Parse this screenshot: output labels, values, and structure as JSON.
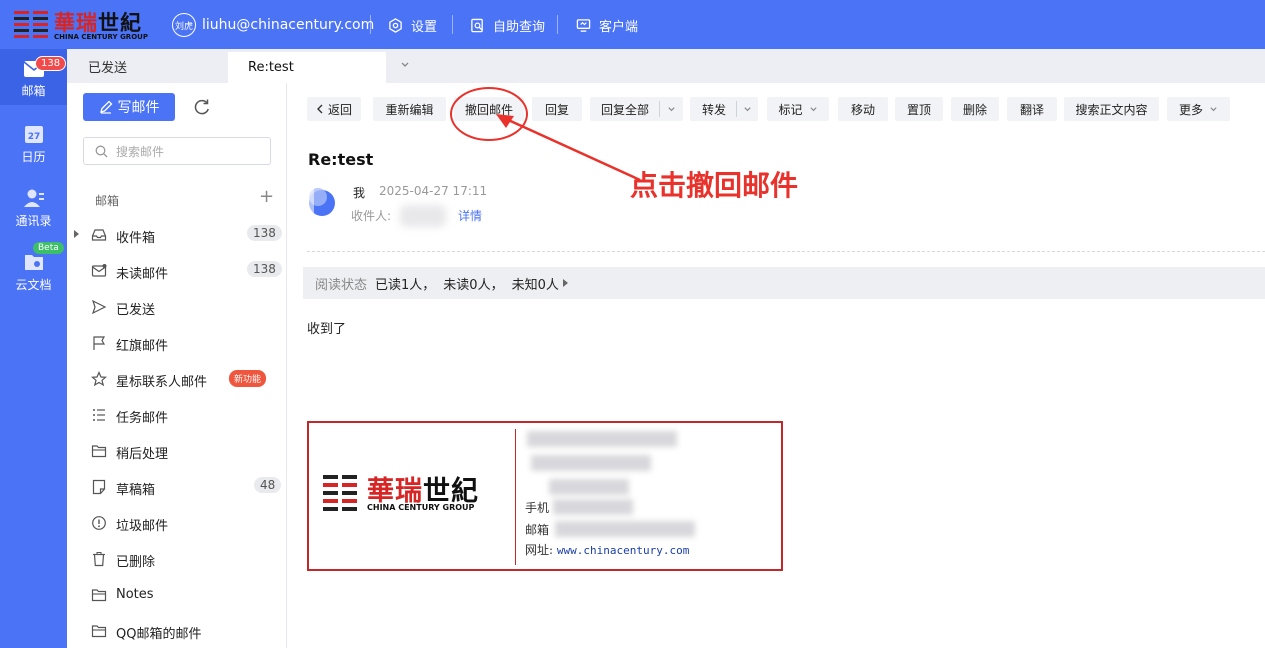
{
  "header": {
    "logo": {
      "cn_red": "華瑞",
      "cn_black": "世紀",
      "en": "CHINA CENTURY GROUP"
    },
    "user_avatar_text": "刘虎",
    "user_email": "liuhu@chinacentury.com",
    "links": [
      {
        "label": "设置",
        "icon": "gear-icon"
      },
      {
        "label": "自助查询",
        "icon": "search-doc-icon"
      },
      {
        "label": "客户端",
        "icon": "monitor-icon"
      }
    ]
  },
  "leftnav": {
    "items": [
      {
        "label": "邮箱",
        "icon": "mail-icon",
        "badge": "138",
        "active": true
      },
      {
        "label": "日历",
        "icon": "calendar-icon",
        "day": "27"
      },
      {
        "label": "通讯录",
        "icon": "contacts-icon"
      },
      {
        "label": "云文档",
        "icon": "cloud-doc-icon",
        "badge": "Beta"
      }
    ]
  },
  "tabs": [
    {
      "label": "已发送"
    },
    {
      "label": "Re:test"
    }
  ],
  "folders": {
    "write_label": "写邮件",
    "search_placeholder": "搜索邮件",
    "section_label": "邮箱",
    "items": [
      {
        "label": "收件箱",
        "count": "138",
        "icon": "inbox-icon"
      },
      {
        "label": "未读邮件",
        "count": "138",
        "icon": "unread-icon"
      },
      {
        "label": "已发送",
        "icon": "send-icon"
      },
      {
        "label": "红旗邮件",
        "icon": "flag-icon"
      },
      {
        "label": "星标联系人邮件",
        "tag": "新功能",
        "icon": "star-icon"
      },
      {
        "label": "任务邮件",
        "icon": "task-list-icon"
      },
      {
        "label": "稍后处理",
        "icon": "folder-icon"
      },
      {
        "label": "草稿箱",
        "count": "48",
        "icon": "draft-icon"
      },
      {
        "label": "垃圾邮件",
        "icon": "spam-icon"
      },
      {
        "label": "已删除",
        "icon": "trash-icon"
      },
      {
        "label": "Notes",
        "icon": "folder-icon"
      },
      {
        "label": "QQ邮箱的邮件",
        "icon": "folder-icon"
      }
    ]
  },
  "toolbar": {
    "back": "返回",
    "reedit": "重新编辑",
    "recall": "撤回邮件",
    "reply": "回复",
    "reply_all": "回复全部",
    "forward": "转发",
    "mark": "标记",
    "move": "移动",
    "pin": "置顶",
    "delete": "删除",
    "translate": "翻译",
    "search_body": "搜索正文内容",
    "more": "更多"
  },
  "mail": {
    "subject": "Re:test",
    "sender": "我",
    "date": "2025-04-27 17:11",
    "recipient_label": "收件人:",
    "detail_link": "详情",
    "read_status_label": "阅读状态",
    "read": "已读1人，",
    "unread": "未读0人，",
    "unknown": "未知0人",
    "body": "收到了",
    "signature": {
      "phone_label": "手机",
      "email_label": "邮箱",
      "web_label": "网址:",
      "web_value": "www.chinacentury.com"
    }
  },
  "annotation": {
    "text": "点击撤回邮件",
    "color": "#e8322b"
  }
}
